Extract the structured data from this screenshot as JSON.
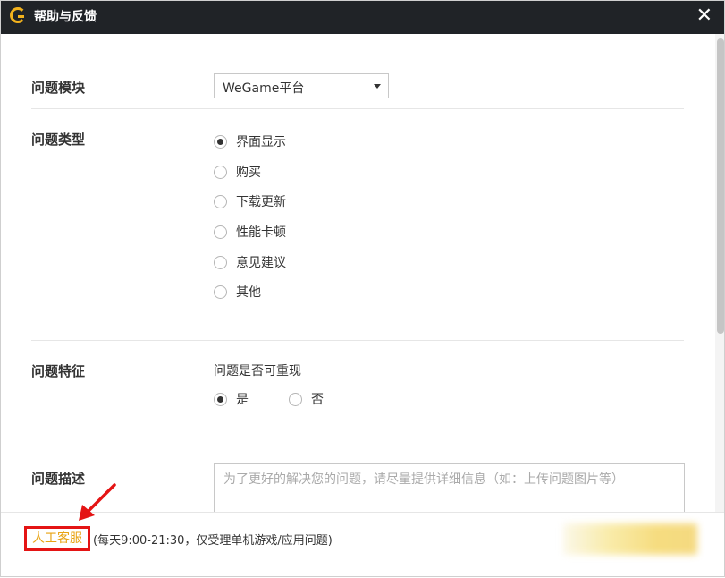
{
  "window": {
    "title": "帮助与反馈",
    "close_glyph": "✕"
  },
  "form": {
    "module": {
      "label": "问题模块",
      "selected": "WeGame平台"
    },
    "type": {
      "label": "问题类型",
      "options": [
        "界面显示",
        "购买",
        "下载更新",
        "性能卡顿",
        "意见建议",
        "其他"
      ],
      "selected_index": 0
    },
    "feature": {
      "label": "问题特征",
      "question": "问题是否可重现",
      "options": [
        "是",
        "否"
      ],
      "selected_index": 0
    },
    "description": {
      "label": "问题描述",
      "placeholder": "为了更好的解决您的问题，请尽量提供详细信息（如：上传问题图片等）"
    }
  },
  "footer": {
    "support_link": "人工客服",
    "hours": "(每天9:00-21:30，仅受理单机游戏/应用问题)"
  },
  "colors": {
    "accent": "#f2b21d",
    "highlight_border": "#e41414",
    "link": "#e8a313",
    "titlebar": "#202327"
  }
}
